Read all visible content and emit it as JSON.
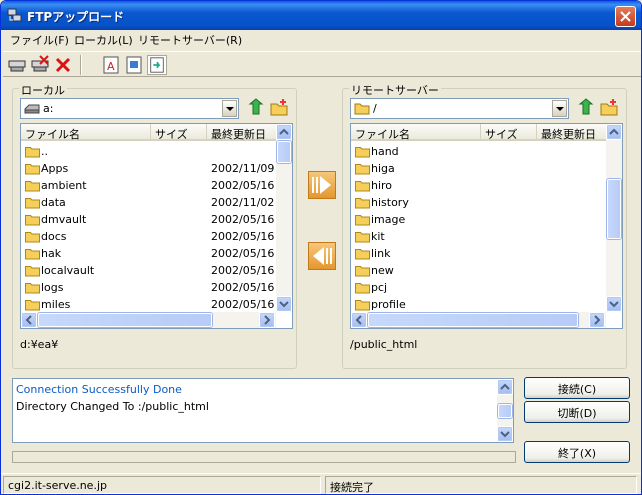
{
  "window": {
    "title": "FTPアップロード"
  },
  "menu": [
    "ファイル(F)",
    "ローカル(L)",
    "リモートサーバー(R)"
  ],
  "toolbar": {
    "icons": [
      "connect-icon",
      "disconnect-icon",
      "delete-icon",
      "text-mode-icon",
      "binary-mode-icon",
      "auto-mode-icon"
    ]
  },
  "local": {
    "label": "ローカル",
    "drive": "a:",
    "columns": [
      "ファイル名",
      "サイズ",
      "最終更新日"
    ],
    "rows": [
      {
        "name": "..",
        "date": ""
      },
      {
        "name": "Apps",
        "date": "2002/11/09"
      },
      {
        "name": "ambient",
        "date": "2002/05/16"
      },
      {
        "name": "data",
        "date": "2002/11/02"
      },
      {
        "name": "dmvault",
        "date": "2002/05/16"
      },
      {
        "name": "docs",
        "date": "2002/05/16"
      },
      {
        "name": "hak",
        "date": "2002/05/16"
      },
      {
        "name": "localvault",
        "date": "2002/05/16"
      },
      {
        "name": "logs",
        "date": "2002/05/16"
      },
      {
        "name": "miles",
        "date": "2002/05/16"
      }
    ],
    "path": "d:¥ea¥"
  },
  "remote": {
    "label": "リモートサーバー",
    "dir": "/",
    "columns": [
      "ファイル名",
      "サイズ",
      "最終更新日"
    ],
    "rows": [
      {
        "name": "hand"
      },
      {
        "name": "higa"
      },
      {
        "name": "hiro"
      },
      {
        "name": "history"
      },
      {
        "name": "image"
      },
      {
        "name": "kit"
      },
      {
        "name": "link"
      },
      {
        "name": "new"
      },
      {
        "name": "pcj"
      },
      {
        "name": "profile"
      }
    ],
    "path": "/public_html"
  },
  "log": [
    "Connection Successfully Done",
    "Directory Changed To :/public_html"
  ],
  "buttons": {
    "connect": "接続(C)",
    "disconnect": "切断(D)",
    "exit": "終了(X)"
  },
  "status": {
    "host": "cgi2.it-serve.ne.jp",
    "state": "接続完了"
  },
  "colors": {
    "title": "#0a58d0",
    "log_blue": "#0a5bc4",
    "accent": "#e5972e"
  }
}
